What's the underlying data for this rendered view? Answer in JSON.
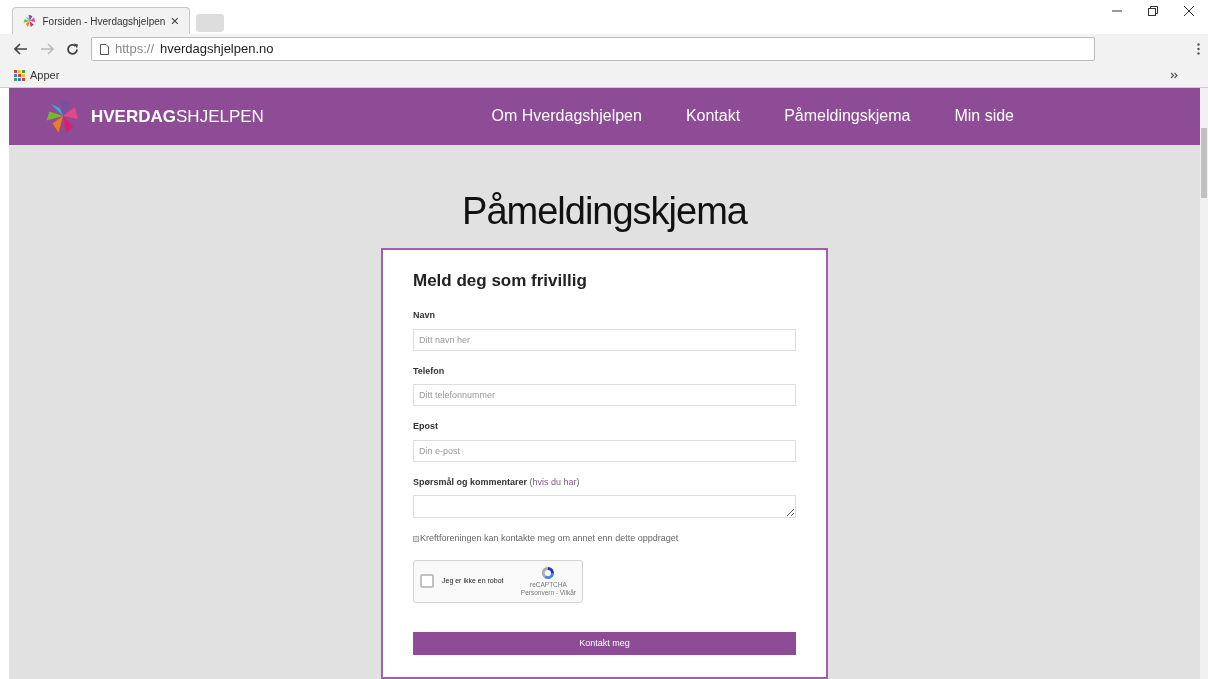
{
  "browser": {
    "tab_title": "Forsiden - Hverdagshjelpen",
    "url_scheme": "https://",
    "url_host": "hverdagshjelpen.no",
    "bookmark": "Apper"
  },
  "site": {
    "brand": "**HVERDAG**SHJELPEN",
    "nav": [
      {
        "label": "Om Hverdagshjelpen",
        "selected": false
      },
      {
        "label": "Kontakt",
        "selected": false
      },
      {
        "label": "Påmeldingskjema",
        "selected": false
      },
      {
        "label": "Min side",
        "selected": false
      }
    ]
  },
  "page_title": "Påmeldingskjema",
  "form": {
    "title": "Meld deg som frivillig",
    "fields": [
      {
        "kind": "input",
        "label": "Navn",
        "placeholder": "Ditt navn her"
      },
      {
        "kind": "input",
        "label": "Telefon",
        "placeholder": "Ditt telefonnummer"
      },
      {
        "kind": "input",
        "label": "Epost",
        "placeholder": "Din e-post"
      },
      {
        "kind": "textarea",
        "label": "Spørsmål og kommentarer",
        "hint": "(hvis du har)"
      }
    ],
    "consent": {
      "label": "Kreftforeningen kan kontakte meg om annet enn dette oppdraget",
      "checked": false
    },
    "captcha": {
      "label": "Jeg er ikke en robot",
      "checked": false,
      "brand": "reCAPTCHA",
      "links": "Personvern - Vilkår"
    },
    "submit": "Kontakt meg"
  }
}
